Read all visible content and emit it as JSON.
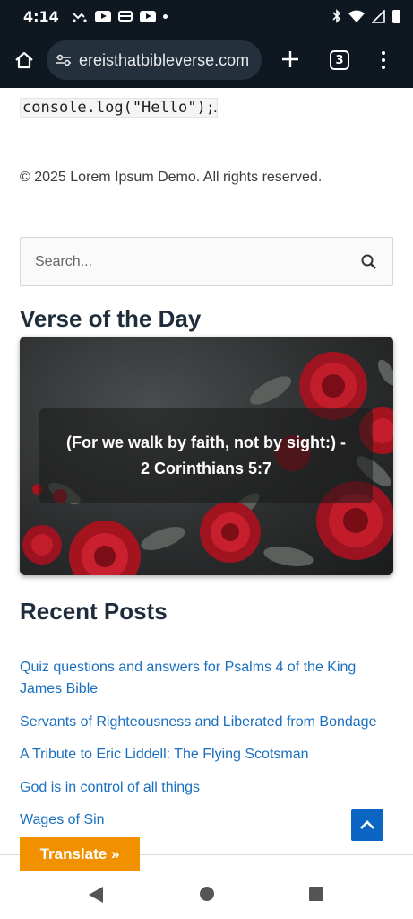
{
  "status_bar": {
    "time": "4:14"
  },
  "browser": {
    "url": "ereisthatbibleverse.com",
    "tab_count": "3"
  },
  "page": {
    "code_snippet": "console.log(\"Hello\");",
    "code_tail": ".",
    "copyright": "© 2025 Lorem Ipsum Demo. All rights reserved.",
    "search_placeholder": "Search...",
    "verse_of_day": {
      "heading": "Verse of the Day",
      "text_line1": "(For we walk by faith, not by sight:) -",
      "text_line2": "2 Corinthians 5:7"
    },
    "recent_posts": {
      "heading": "Recent Posts",
      "items": [
        {
          "label": "Quiz questions and answers for Psalms 4 of the King James Bible"
        },
        {
          "label": "Servants of Righteousness and Liberated from Bondage"
        },
        {
          "label": "A Tribute to Eric Liddell: The Flying Scotsman"
        },
        {
          "label": "God is in control of all things"
        },
        {
          "label": "Wages of Sin"
        }
      ]
    },
    "translate_label": "Translate »"
  },
  "colors": {
    "link": "#1a6fbf",
    "heading": "#1e2c3b",
    "translate": "#f29100",
    "scroll_top": "#0a66c2",
    "browser_bg": "#0f1720"
  },
  "icons": [
    "home-icon",
    "site-settings-icon",
    "new-tab-icon",
    "tab-switcher-icon",
    "overflow-menu-icon",
    "search-icon",
    "chevron-up-icon",
    "nav-back-icon",
    "nav-home-icon",
    "nav-recents-icon"
  ]
}
